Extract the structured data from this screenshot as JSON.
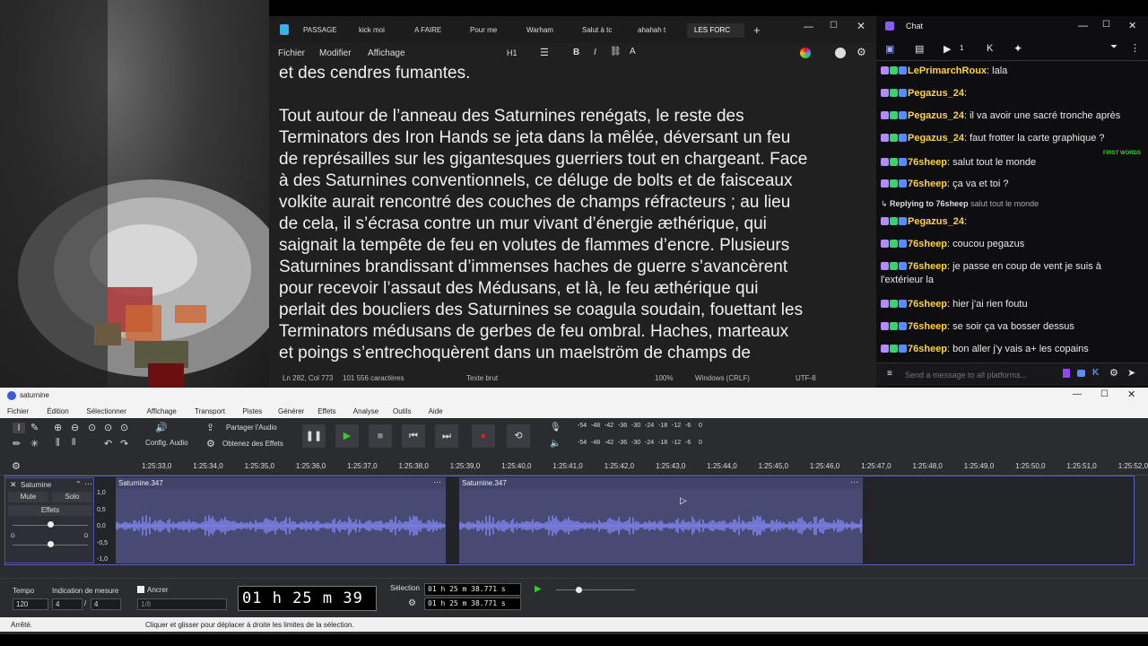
{
  "notepad": {
    "tabs": [
      "PASSAGE",
      "kick moi",
      "A FAIRE",
      "Pour me",
      "Warham",
      "Salut à tc",
      "ahahah t",
      "LES FORC"
    ],
    "menu": [
      "Fichier",
      "Modifier",
      "Affichage"
    ],
    "heading_label": "H1",
    "lines": [
      "et des cendres fumantes.",
      "",
      "Tout autour de l’anneau des Saturnines renégats, le reste des",
      "Terminators des Iron Hands se jeta dans la mêlée, déversant un feu",
      "de représailles sur les gigantesques guerriers tout en chargeant. Face",
      "à des Saturnines conventionnels, ce déluge de bolts et de faisceaux",
      "volkite aurait rencontré des couches de champs réfracteurs ; au lieu",
      "de cela, il s’écrasa contre un mur vivant d’énergie æthérique, qui",
      "saignait la tempête de feu en volutes de flammes d’encre. Plusieurs",
      "Saturnines brandissant d’immenses haches de guerre s’avancèrent",
      "pour recevoir l’assaut des Médusans, et là, le feu æthérique qui",
      "perlait des boucliers des Saturnines se coagula soudain, fouettant les",
      "Terminators médusans de gerbes de feu ombral. Haches, marteaux",
      "et poings s’entrechoquèrent dans un maelström de champs de"
    ],
    "status": {
      "position": "Ln 282, Col 773",
      "chars": "101 556 caractères",
      "format": "Texte brut",
      "zoom": "100%",
      "eol": "Windows (CRLF)",
      "enc": "UTF-8"
    }
  },
  "chat": {
    "title": "Chat",
    "tab_count": "1",
    "first_words_tag": "FIRST WORDS",
    "replying": "Replying to 76sheep",
    "replying_text": "salut tout le monde",
    "messages": [
      {
        "user": "LePrimarchRoux",
        "color": "#ffd23f",
        "text": "lala"
      },
      {
        "user": "Pegazus_24",
        "color": "#ffd23f",
        "text": ""
      },
      {
        "user": "Pegazus_24",
        "color": "#ffd23f",
        "text": "il va avoir une sacré tronche après"
      },
      {
        "user": "Pegazus_24",
        "color": "#ffd23f",
        "text": "faut frotter la carte graphique ?"
      },
      {
        "user": "76sheep",
        "color": "#ffd23f",
        "text": "salut tout le monde"
      },
      {
        "user": "76sheep",
        "color": "#ffd23f",
        "text": "ça va et toi ?"
      },
      {
        "user": "Pegazus_24",
        "color": "#ffd23f",
        "text": ""
      },
      {
        "user": "76sheep",
        "color": "#ffd23f",
        "text": "coucou pegazus"
      },
      {
        "user": "76sheep",
        "color": "#ffd23f",
        "text": "je passe en coup de vent je suis à"
      },
      {
        "user": "",
        "color": "#ffd23f",
        "text": "l'extérieur la"
      },
      {
        "user": "76sheep",
        "color": "#ffd23f",
        "text": "hier j'ai rien foutu"
      },
      {
        "user": "76sheep",
        "color": "#ffd23f",
        "text": "se soir ça va bosser dessus"
      },
      {
        "user": "76sheep",
        "color": "#ffd23f",
        "text": "bon aller j'y vais a+ les copains"
      }
    ],
    "input_placeholder": "Send a message to all platforms..."
  },
  "audacity": {
    "title": "saturnine",
    "menu": [
      "Fichier",
      "Édition",
      "Sélectionner",
      "Affichage",
      "Transport",
      "Pistes",
      "Générer",
      "Effets",
      "Analyse",
      "Outils",
      "Aide"
    ],
    "audio_setup": "Config. Audio",
    "share_audio": "Partager l'Audio",
    "get_effects": "Obtenez des Effets",
    "meter_ticks": [
      "-54",
      "-48",
      "-42",
      "-36",
      "-30",
      "-24",
      "-18",
      "-12",
      "-6",
      "0"
    ],
    "ruler": [
      "1:25:33,0",
      "1:25:34,0",
      "1:25:35,0",
      "1:25:36,0",
      "1:25:37,0",
      "1:25:38,0",
      "1:25:39,0",
      "1:25:40,0",
      "1:25:41,0",
      "1:25:42,0",
      "1:25:43,0",
      "1:25:44,0",
      "1:25:45,0",
      "1:25:46,0",
      "1:25:47,0",
      "1:25:48,0",
      "1:25:49,0",
      "1:25:50,0",
      "1:25:51,0",
      "1:25:52,0"
    ],
    "track": {
      "name": "Saturnine",
      "mute": "Mute",
      "solo": "Solo",
      "effects": "Effets",
      "pan_l": "G",
      "pan_r": "D",
      "scale": [
        "1,0",
        "0,5",
        "0,0",
        "-0,5",
        "-1,0"
      ]
    },
    "clips": [
      "Saturnine.347",
      "Saturnine.347"
    ],
    "bottom": {
      "tempo_label": "Tempo",
      "tempo": "120",
      "meter_label": "Indication de mesure",
      "meter_num": "4",
      "meter_den": "4",
      "snap": "Ancrer",
      "snap_val": "1/8",
      "time": "01 h 25 m 39 s",
      "selection_label": "Sélection",
      "sel_start": "01 h 25 m 38.771 s",
      "sel_end": "01 h 25 m 38.771 s"
    },
    "status_left": "Arrêté.",
    "status_hint": "Cliquer et glisser pour déplacer à droite les limites de la sélection."
  }
}
